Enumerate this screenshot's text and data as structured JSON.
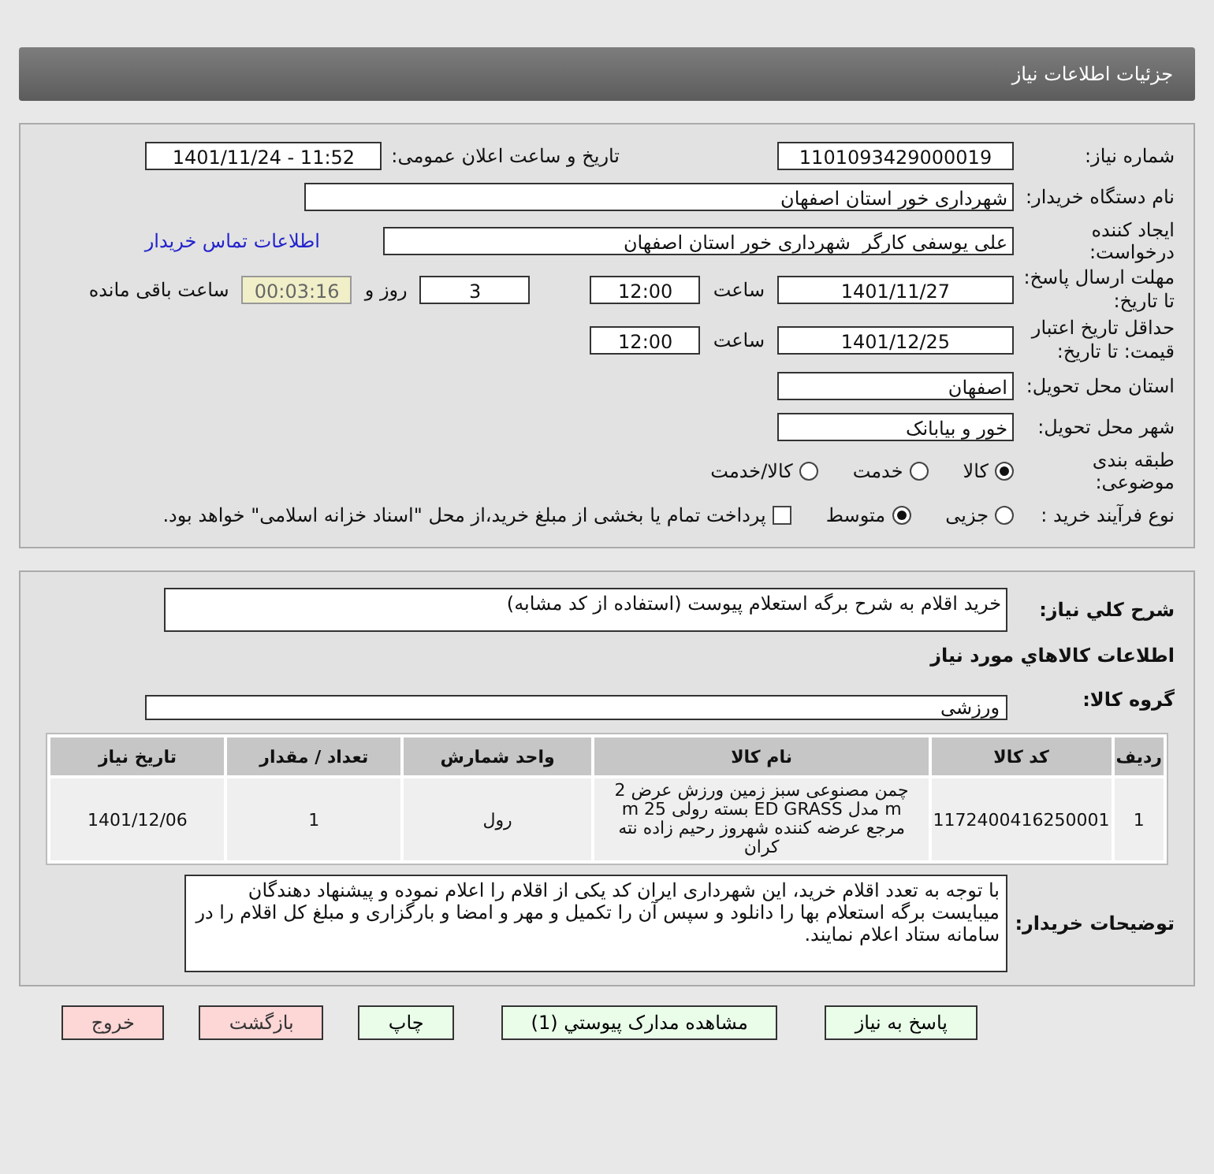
{
  "header": {
    "title": "جزئیات اطلاعات نیاز"
  },
  "need_number": {
    "label": "شماره نیاز:",
    "value": "1101093429000019"
  },
  "announce": {
    "label": "تاریخ و ساعت اعلان عمومی:",
    "value": "1401/11/24 - 11:52"
  },
  "buyer_org": {
    "label": "نام دستگاه خریدار:",
    "value": "شهرداری خور استان اصفهان"
  },
  "requester": {
    "label": "ایجاد کننده درخواست:",
    "value": "علی یوسفی کارگر  شهرداری خور استان اصفهان",
    "link": "اطلاعات تماس خریدار"
  },
  "deadline": {
    "label": "مهلت ارسال پاسخ: تا تاریخ:",
    "date": "1401/11/27",
    "time_label": "ساعت",
    "time": "12:00",
    "days": "3",
    "days_label": "روز و",
    "remaining": "00:03:16",
    "remaining_label": "ساعت باقی مانده"
  },
  "validity": {
    "label": "حداقل تاریخ اعتبار قیمت: تا تاریخ:",
    "date": "1401/12/25",
    "time_label": "ساعت",
    "time": "12:00"
  },
  "province": {
    "label": "استان محل تحویل:",
    "value": "اصفهان"
  },
  "city": {
    "label": "شهر محل تحویل:",
    "value": "خور و بیابانک"
  },
  "category": {
    "label": "طبقه بندی موضوعی:",
    "options": [
      {
        "label": "کالا",
        "selected": true
      },
      {
        "label": "خدمت",
        "selected": false
      },
      {
        "label": "کالا/خدمت",
        "selected": false
      }
    ]
  },
  "process": {
    "label": "نوع فرآیند خرید :",
    "options": [
      {
        "label": "جزیی",
        "selected": false
      },
      {
        "label": "متوسط",
        "selected": true
      }
    ],
    "payment": {
      "checked": false,
      "label": "پرداخت تمام یا بخشی از مبلغ خرید،از محل \"اسناد خزانه اسلامی\" خواهد بود."
    }
  },
  "description": {
    "label": "شرح کلي نياز:",
    "value": "خرید اقلام به شرح برگه استعلام پیوست (استفاده از کد مشابه)"
  },
  "items_heading": "اطلاعات کالاهاي مورد نياز",
  "goods_group": {
    "label": "گروه کالا:",
    "value": "ورزشی"
  },
  "table": {
    "columns": [
      "ردیف",
      "کد کالا",
      "نام کالا",
      "واحد شمارش",
      "تعداد / مقدار",
      "تاریخ نیاز"
    ],
    "rows": [
      [
        "1",
        "1172400416250001",
        "چمن مصنوعی سبز زمین ورزش عرض 2 m مدل ED GRASS بسته رولی 25 m مرجع عرضه کننده شهروز رحیم زاده نته کران",
        "رول",
        "1",
        "1401/12/06"
      ]
    ]
  },
  "buyer_notes": {
    "label": "توضیحات خریدار:",
    "value": "با توجه به تعدد اقلام خرید، این شهرداری ایران کد یکی از اقلام را اعلام نموده و پیشنهاد دهندگان میبایست برگه استعلام بها را دانلود و سپس آن را تکمیل و مهر و امضا و بارگزاری و مبلغ کل اقلام را در سامانه ستاد اعلام نمایند."
  },
  "buttons": [
    {
      "label": "پاسخ به نیاز",
      "kind": "normal"
    },
    {
      "label": "مشاهده مدارک پیوستي (1)",
      "kind": "normal"
    },
    {
      "label": "چاپ",
      "kind": "normal"
    },
    {
      "label": "بازگشت",
      "kind": "exit"
    },
    {
      "label": "خروج",
      "kind": "exit"
    }
  ]
}
